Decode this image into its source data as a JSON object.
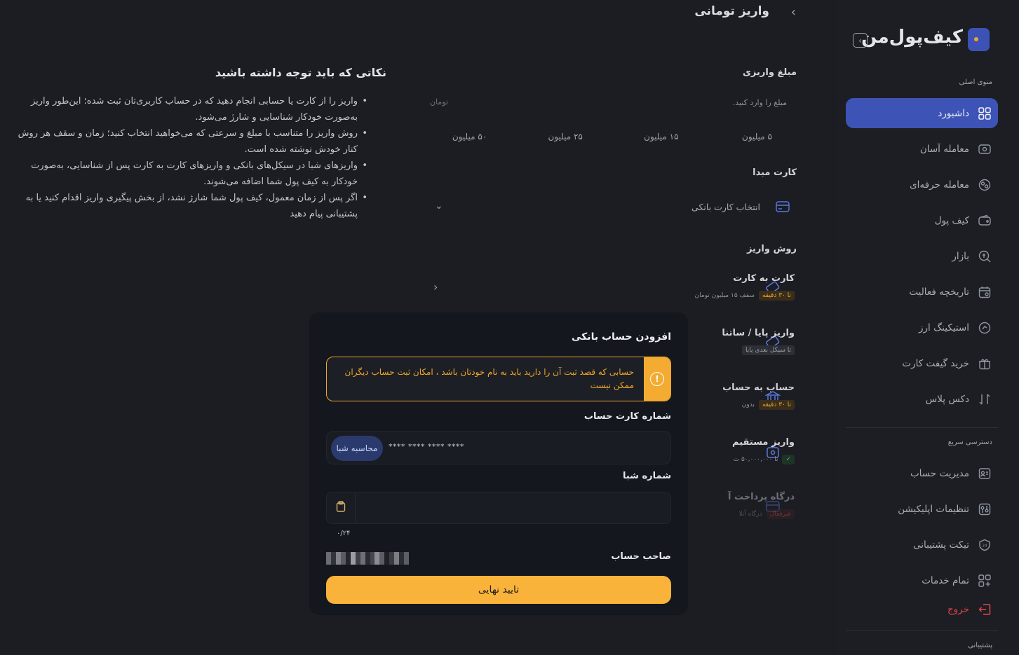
{
  "sidebar": {
    "logo_text": "کیف‌پول‌من",
    "main_menu_label": "منوی اصلی",
    "items": [
      {
        "label": "داشبورد",
        "icon": "grid-icon",
        "active": true
      },
      {
        "label": "معامله آسان",
        "icon": "easy-trade-icon"
      },
      {
        "label": "معامله حرفه‌ای",
        "icon": "pro-trade-icon"
      },
      {
        "label": "کیف پول",
        "icon": "wallet-icon"
      },
      {
        "label": "بازار",
        "icon": "market-icon"
      },
      {
        "label": "تاریخچه فعالیت",
        "icon": "calendar-icon"
      },
      {
        "label": "استیکینگ ارز",
        "icon": "staking-icon"
      },
      {
        "label": "خرید گیفت کارت",
        "icon": "gift-icon"
      },
      {
        "label": "دکس پلاس",
        "icon": "dex-icon"
      }
    ],
    "quick_access_label": "دسترسی سریع",
    "quick_items": [
      {
        "label": "مدیریت حساب",
        "icon": "account-icon"
      },
      {
        "label": "تنظیمات اپلیکیشن",
        "icon": "settings-icon"
      },
      {
        "label": "تیکت پشتیبانی",
        "icon": "support-ticket-icon"
      },
      {
        "label": "تمام خدمات",
        "icon": "all-services-icon"
      },
      {
        "label": "خروج",
        "icon": "logout-icon"
      }
    ],
    "support_label": "پشتیبانی"
  },
  "page": {
    "title": "واریز تومانی"
  },
  "form": {
    "amount_label": "مبلغ واریزی",
    "amount_placeholder": "مبلغ را وارد کنید.",
    "amount_unit": "تومان",
    "chips": [
      "۵ میلیون",
      "۱۵ میلیون",
      "۲۵ میلیون",
      "۵۰ میلیون"
    ],
    "source_card_label": "کارت مبدا",
    "source_card_placeholder": "انتخاب کارت بانکی",
    "method_label": "روش واریز",
    "methods": [
      {
        "title": "کارت به کارت",
        "tag": "تا ۳۰ دقیقه",
        "sub": "سقف ۱۵ میلیون تومان"
      },
      {
        "title": "واریز پایا / ساتنا",
        "tag": "تا سیکل بعدی پایا",
        "sub": ""
      },
      {
        "title": "حساب به حساب",
        "tag": "تا ۳۰ دقیقه",
        "sub": "بدون"
      },
      {
        "title": "واریز مستقیم",
        "tag": "✓",
        "sub": "تا ۵۰,۰۰۰,۰۰۰ ت"
      },
      {
        "title": "درگاه پرداخت آ",
        "tag": "غیرفعال",
        "sub": "درگاه آنلا"
      }
    ]
  },
  "notes": {
    "title": "نکاتی که باید توجه داشته باشید",
    "items": [
      "واریز را از کارت یا حسابی انجام دهید که در حساب کاربری‌تان ثبت شده؛ این‌طور واریز به‌صورت خودکار شناسایی و شارژ می‌شود.",
      "روش واریز را متناسب با مبلغ و سرعتی که می‌خواهید انتخاب کنید؛ زمان و سقف هر روش کنار خودش نوشته شده است.",
      "واریزهای شبا در سیکل‌های بانکی و واریزهای کارت به کارت پس از شناسایی، به‌صورت خودکار به کیف پول شما اضافه می‌شوند.",
      "اگر پس از زمان معمول، کیف پول شما شارژ نشد، از بخش پیگیری واریز اقدام کنید یا به پشتیبانی پیام دهید"
    ]
  },
  "modal": {
    "title": "افزودن حساب بانکی",
    "alert_text": "حسابی که قصد ثبت آن را دارید باید به نام خودتان باشد ، امکان ثبت حساب دیگران ممکن نیست",
    "card_label": "شماره کارت حساب",
    "card_value": "**** **** **** ****",
    "calc_button": "محاسبه شبا",
    "sheba_label": "شماره شبا",
    "sheba_value": "",
    "counter": "۰/۲۴",
    "owner_label": "صاحب حساب",
    "confirm_button": "تایید نهایی"
  },
  "colors": {
    "accent": "#3d53b6",
    "warning": "#f4ab32",
    "danger": "#e0474e"
  }
}
